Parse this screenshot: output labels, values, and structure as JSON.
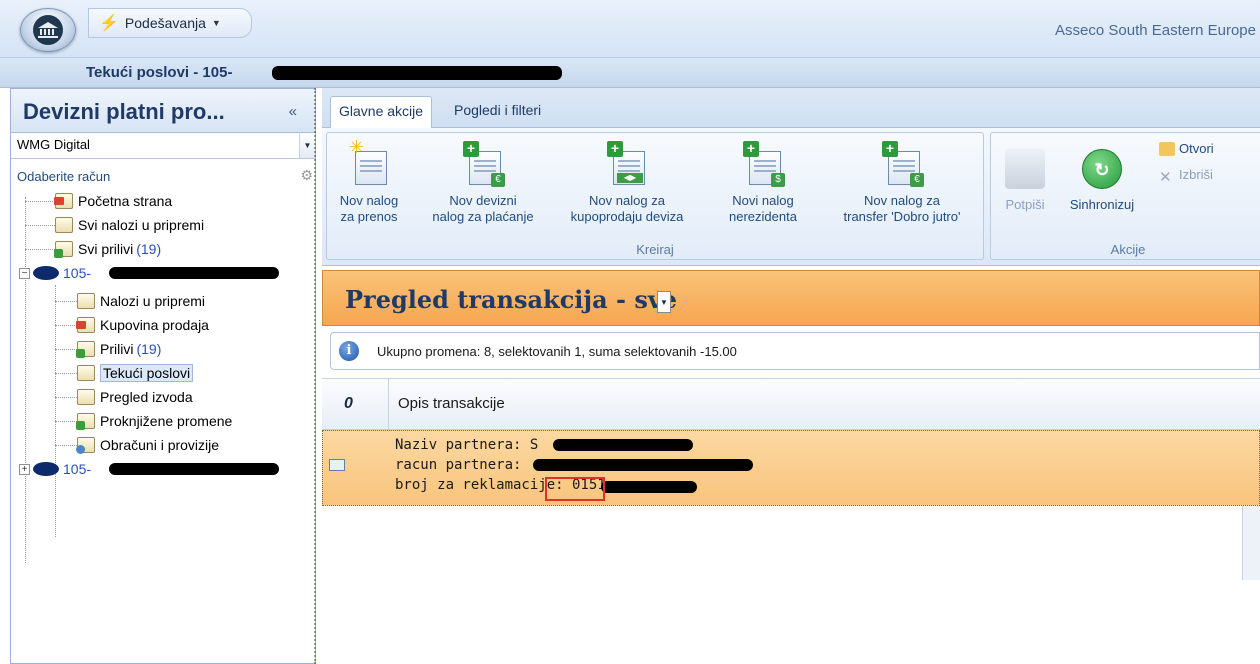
{
  "app": {
    "qat_label": "Podešavanja",
    "company": "Asseco South Eastern Europe",
    "window_title": "Tekući poslovi - 105-"
  },
  "left_panel": {
    "title": "Devizni platni pro...",
    "collapse": "«",
    "combo_value": "WMG Digital",
    "select_account_label": "Odaberite račun",
    "tree": {
      "pocetna": "Početna strana",
      "svi_nalozi": "Svi nalozi u pripremi",
      "svi_prilivi": "Svi prilivi",
      "svi_prilivi_count": "(19)",
      "account1": "105-",
      "nalozi": "Nalozi u pripremi",
      "kupovina": "Kupovina prodaja",
      "prilivi": "Prilivi",
      "prilivi_count": "(19)",
      "tekuci": "Tekući poslovi",
      "pregled": "Pregled izvoda",
      "proknjizene": "Proknjižene promene",
      "obracuni": "Obračuni i provizije",
      "account2": "105-"
    }
  },
  "ribbon": {
    "tabs": [
      "Glavne akcije",
      "Pogledi i filteri"
    ],
    "kreiraj": {
      "label": "Kreiraj",
      "buttons": [
        {
          "line1": "Nov nalog",
          "line2": "za prenos"
        },
        {
          "line1": "Nov devizni",
          "line2": "nalog za plaćanje"
        },
        {
          "line1": "Nov nalog za",
          "line2": "kupoprodaju deviza"
        },
        {
          "line1": "Novi nalog",
          "line2": "nerezidenta"
        },
        {
          "line1": "Nov nalog za",
          "line2": "transfer 'Dobro jutro'"
        }
      ]
    },
    "akcije": {
      "label": "Akcije",
      "potpisi": "Potpiši",
      "sinhronizuj": "Sinhronizuj",
      "otvori": "Otvori",
      "izbrisi": "Izbriši"
    }
  },
  "main": {
    "header_title": "Pregled transakcija - sve",
    "info_text": "Ukupno promena: 8, selektovanih 1, suma selektovanih -15.00",
    "grid": {
      "col_attach": "0",
      "col_opis": "Opis transakcije",
      "row": {
        "line1": "Naziv partnera: S",
        "line2": "racun partnera: ",
        "line3": "broj za reklamacije: 0151"
      }
    }
  },
  "colors": {
    "accent_orange": "#f6a650",
    "highlight_red": "#e0302c",
    "ribbon_blue": "#dce8f6"
  }
}
